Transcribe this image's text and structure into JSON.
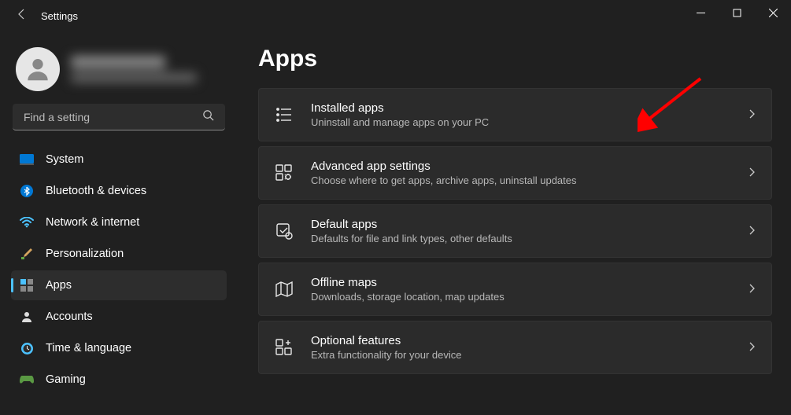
{
  "titlebar": {
    "title": "Settings"
  },
  "search": {
    "placeholder": "Find a setting"
  },
  "sidebar": {
    "items": [
      {
        "label": "System",
        "icon": "system-icon"
      },
      {
        "label": "Bluetooth & devices",
        "icon": "bluetooth-icon"
      },
      {
        "label": "Network & internet",
        "icon": "wifi-icon"
      },
      {
        "label": "Personalization",
        "icon": "brush-icon"
      },
      {
        "label": "Apps",
        "icon": "apps-icon",
        "active": true
      },
      {
        "label": "Accounts",
        "icon": "accounts-icon"
      },
      {
        "label": "Time & language",
        "icon": "time-icon"
      },
      {
        "label": "Gaming",
        "icon": "gaming-icon"
      }
    ]
  },
  "page": {
    "title": "Apps",
    "cards": [
      {
        "title": "Installed apps",
        "desc": "Uninstall and manage apps on your PC",
        "icon": "list-icon"
      },
      {
        "title": "Advanced app settings",
        "desc": "Choose where to get apps, archive apps, uninstall updates",
        "icon": "advanced-icon"
      },
      {
        "title": "Default apps",
        "desc": "Defaults for file and link types, other defaults",
        "icon": "default-icon"
      },
      {
        "title": "Offline maps",
        "desc": "Downloads, storage location, map updates",
        "icon": "map-icon"
      },
      {
        "title": "Optional features",
        "desc": "Extra functionality for your device",
        "icon": "features-icon"
      }
    ]
  }
}
